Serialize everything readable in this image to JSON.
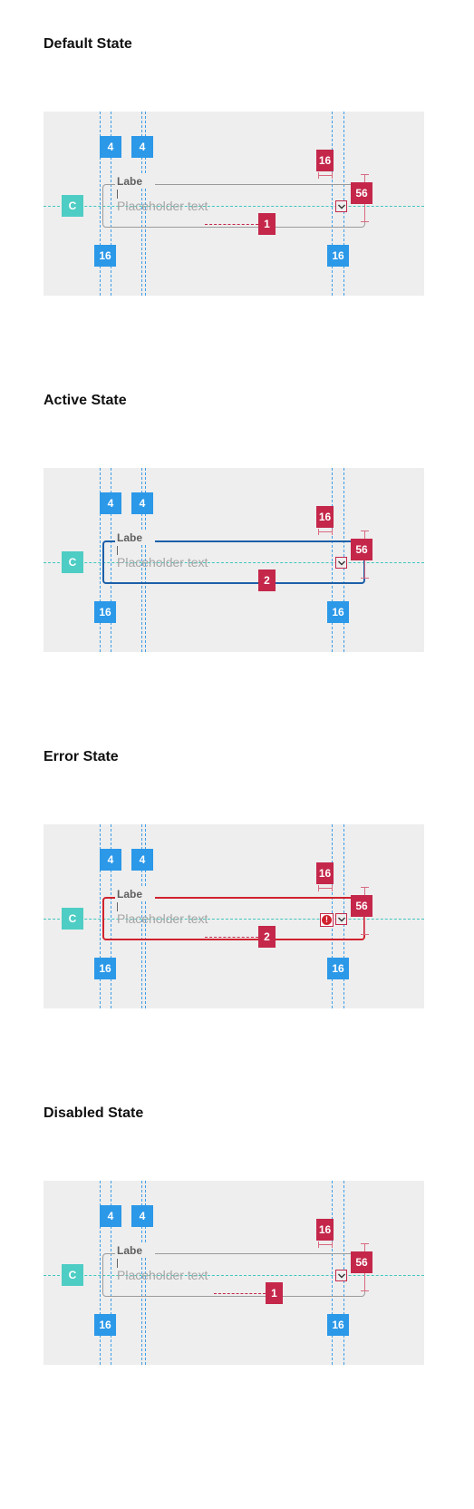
{
  "sections": [
    {
      "title": "Default State",
      "variant": "default",
      "callout": "1"
    },
    {
      "title": "Active State",
      "variant": "active",
      "callout": "2"
    },
    {
      "title": "Error State",
      "variant": "error",
      "callout": "2"
    },
    {
      "title": "Disabled State",
      "variant": "disabled",
      "callout": "1"
    }
  ],
  "field": {
    "label": "Labe",
    "placeholder": "Placeholder text",
    "trailing_icon": "chevron-down-icon",
    "error_icon": "error-icon",
    "error_glyph": "!"
  },
  "specs": {
    "label_spacing_left": "4",
    "label_spacing_right": "4",
    "padding_left": "16",
    "padding_right": "16",
    "icon_spacing": "16",
    "height": "56",
    "center_marker": "C"
  },
  "colors": {
    "spec_blue": "#2b98e8",
    "spec_red": "#c4274a",
    "center_teal": "#4ecdc4",
    "border_default": "#9b9b9b",
    "border_active": "#1b5fa8",
    "border_error": "#d0222e",
    "canvas_bg": "#eeeeee"
  }
}
